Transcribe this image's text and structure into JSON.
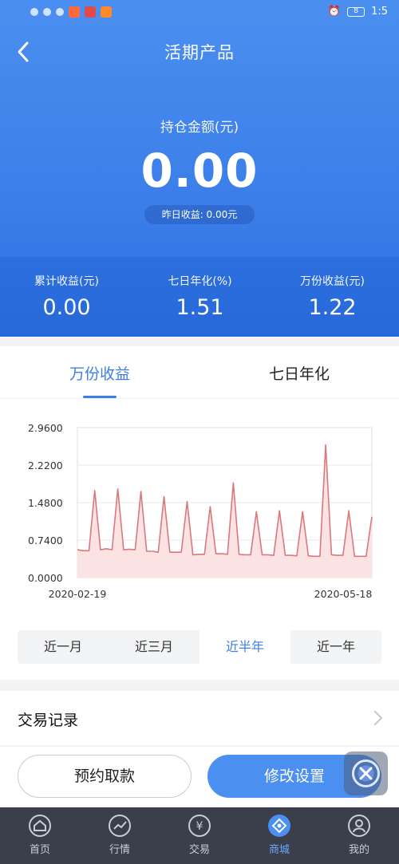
{
  "status": {
    "time": "1:5",
    "battery": "8"
  },
  "header": {
    "title": "活期产品"
  },
  "holding": {
    "label": "持仓金额(元)",
    "amount": "0.00",
    "yesterday": "昨日收益: 0.00元"
  },
  "stats": [
    {
      "label": "累计收益(元)",
      "value": "0.00"
    },
    {
      "label": "七日年化(%)",
      "value": "1.51"
    },
    {
      "label": "万份收益(元)",
      "value": "1.22"
    }
  ],
  "tabs": [
    {
      "label": "万份收益"
    },
    {
      "label": "七日年化"
    }
  ],
  "periods": [
    {
      "label": "近一月"
    },
    {
      "label": "近三月"
    },
    {
      "label": "近半年"
    },
    {
      "label": "近一年"
    }
  ],
  "record": {
    "label": "交易记录"
  },
  "buttons": {
    "withdraw": "预约取款",
    "modify": "修改设置"
  },
  "nav": [
    {
      "label": "首页",
      "icon": "home-icon"
    },
    {
      "label": "行情",
      "icon": "chart-icon"
    },
    {
      "label": "交易",
      "icon": "yuan-icon"
    },
    {
      "label": "商城",
      "icon": "mall-icon"
    },
    {
      "label": "我的",
      "icon": "user-icon"
    }
  ],
  "colors": {
    "accent": "#3b7ee9",
    "line": "#d9797c",
    "fill": "#fbe3e4"
  },
  "chart_data": {
    "type": "area",
    "y_ticks": [
      "2.9600",
      "2.2200",
      "1.4800",
      "0.7400",
      "0.0000"
    ],
    "ylim": [
      0,
      2.96
    ],
    "x_labels": [
      "2020-02-19",
      "2020-05-18"
    ],
    "values": [
      0.55,
      0.53,
      0.53,
      1.72,
      0.55,
      0.57,
      0.55,
      1.75,
      0.55,
      0.56,
      0.55,
      1.7,
      0.52,
      0.52,
      0.5,
      1.6,
      0.5,
      0.5,
      0.5,
      1.5,
      0.45,
      0.46,
      0.46,
      1.4,
      0.47,
      0.47,
      0.46,
      1.87,
      0.46,
      0.45,
      0.45,
      1.3,
      0.45,
      0.45,
      0.44,
      1.32,
      0.44,
      0.44,
      0.43,
      1.3,
      0.43,
      0.42,
      0.42,
      2.62,
      0.45,
      0.44,
      0.44,
      1.32,
      0.42,
      0.42,
      0.42,
      1.2
    ]
  }
}
